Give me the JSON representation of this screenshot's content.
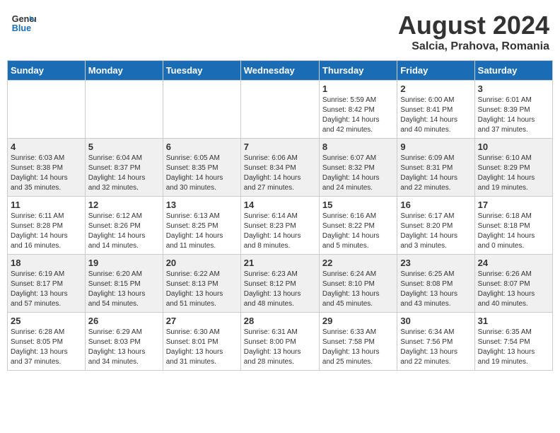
{
  "logo": {
    "line1": "General",
    "line2": "Blue"
  },
  "title": "August 2024",
  "location": "Salcia, Prahova, Romania",
  "weekdays": [
    "Sunday",
    "Monday",
    "Tuesday",
    "Wednesday",
    "Thursday",
    "Friday",
    "Saturday"
  ],
  "weeks": [
    [
      {
        "day": "",
        "info": ""
      },
      {
        "day": "",
        "info": ""
      },
      {
        "day": "",
        "info": ""
      },
      {
        "day": "",
        "info": ""
      },
      {
        "day": "1",
        "info": "Sunrise: 5:59 AM\nSunset: 8:42 PM\nDaylight: 14 hours\nand 42 minutes."
      },
      {
        "day": "2",
        "info": "Sunrise: 6:00 AM\nSunset: 8:41 PM\nDaylight: 14 hours\nand 40 minutes."
      },
      {
        "day": "3",
        "info": "Sunrise: 6:01 AM\nSunset: 8:39 PM\nDaylight: 14 hours\nand 37 minutes."
      }
    ],
    [
      {
        "day": "4",
        "info": "Sunrise: 6:03 AM\nSunset: 8:38 PM\nDaylight: 14 hours\nand 35 minutes."
      },
      {
        "day": "5",
        "info": "Sunrise: 6:04 AM\nSunset: 8:37 PM\nDaylight: 14 hours\nand 32 minutes."
      },
      {
        "day": "6",
        "info": "Sunrise: 6:05 AM\nSunset: 8:35 PM\nDaylight: 14 hours\nand 30 minutes."
      },
      {
        "day": "7",
        "info": "Sunrise: 6:06 AM\nSunset: 8:34 PM\nDaylight: 14 hours\nand 27 minutes."
      },
      {
        "day": "8",
        "info": "Sunrise: 6:07 AM\nSunset: 8:32 PM\nDaylight: 14 hours\nand 24 minutes."
      },
      {
        "day": "9",
        "info": "Sunrise: 6:09 AM\nSunset: 8:31 PM\nDaylight: 14 hours\nand 22 minutes."
      },
      {
        "day": "10",
        "info": "Sunrise: 6:10 AM\nSunset: 8:29 PM\nDaylight: 14 hours\nand 19 minutes."
      }
    ],
    [
      {
        "day": "11",
        "info": "Sunrise: 6:11 AM\nSunset: 8:28 PM\nDaylight: 14 hours\nand 16 minutes."
      },
      {
        "day": "12",
        "info": "Sunrise: 6:12 AM\nSunset: 8:26 PM\nDaylight: 14 hours\nand 14 minutes."
      },
      {
        "day": "13",
        "info": "Sunrise: 6:13 AM\nSunset: 8:25 PM\nDaylight: 14 hours\nand 11 minutes."
      },
      {
        "day": "14",
        "info": "Sunrise: 6:14 AM\nSunset: 8:23 PM\nDaylight: 14 hours\nand 8 minutes."
      },
      {
        "day": "15",
        "info": "Sunrise: 6:16 AM\nSunset: 8:22 PM\nDaylight: 14 hours\nand 5 minutes."
      },
      {
        "day": "16",
        "info": "Sunrise: 6:17 AM\nSunset: 8:20 PM\nDaylight: 14 hours\nand 3 minutes."
      },
      {
        "day": "17",
        "info": "Sunrise: 6:18 AM\nSunset: 8:18 PM\nDaylight: 14 hours\nand 0 minutes."
      }
    ],
    [
      {
        "day": "18",
        "info": "Sunrise: 6:19 AM\nSunset: 8:17 PM\nDaylight: 13 hours\nand 57 minutes."
      },
      {
        "day": "19",
        "info": "Sunrise: 6:20 AM\nSunset: 8:15 PM\nDaylight: 13 hours\nand 54 minutes."
      },
      {
        "day": "20",
        "info": "Sunrise: 6:22 AM\nSunset: 8:13 PM\nDaylight: 13 hours\nand 51 minutes."
      },
      {
        "day": "21",
        "info": "Sunrise: 6:23 AM\nSunset: 8:12 PM\nDaylight: 13 hours\nand 48 minutes."
      },
      {
        "day": "22",
        "info": "Sunrise: 6:24 AM\nSunset: 8:10 PM\nDaylight: 13 hours\nand 45 minutes."
      },
      {
        "day": "23",
        "info": "Sunrise: 6:25 AM\nSunset: 8:08 PM\nDaylight: 13 hours\nand 43 minutes."
      },
      {
        "day": "24",
        "info": "Sunrise: 6:26 AM\nSunset: 8:07 PM\nDaylight: 13 hours\nand 40 minutes."
      }
    ],
    [
      {
        "day": "25",
        "info": "Sunrise: 6:28 AM\nSunset: 8:05 PM\nDaylight: 13 hours\nand 37 minutes."
      },
      {
        "day": "26",
        "info": "Sunrise: 6:29 AM\nSunset: 8:03 PM\nDaylight: 13 hours\nand 34 minutes."
      },
      {
        "day": "27",
        "info": "Sunrise: 6:30 AM\nSunset: 8:01 PM\nDaylight: 13 hours\nand 31 minutes."
      },
      {
        "day": "28",
        "info": "Sunrise: 6:31 AM\nSunset: 8:00 PM\nDaylight: 13 hours\nand 28 minutes."
      },
      {
        "day": "29",
        "info": "Sunrise: 6:33 AM\nSunset: 7:58 PM\nDaylight: 13 hours\nand 25 minutes."
      },
      {
        "day": "30",
        "info": "Sunrise: 6:34 AM\nSunset: 7:56 PM\nDaylight: 13 hours\nand 22 minutes."
      },
      {
        "day": "31",
        "info": "Sunrise: 6:35 AM\nSunset: 7:54 PM\nDaylight: 13 hours\nand 19 minutes."
      }
    ]
  ]
}
